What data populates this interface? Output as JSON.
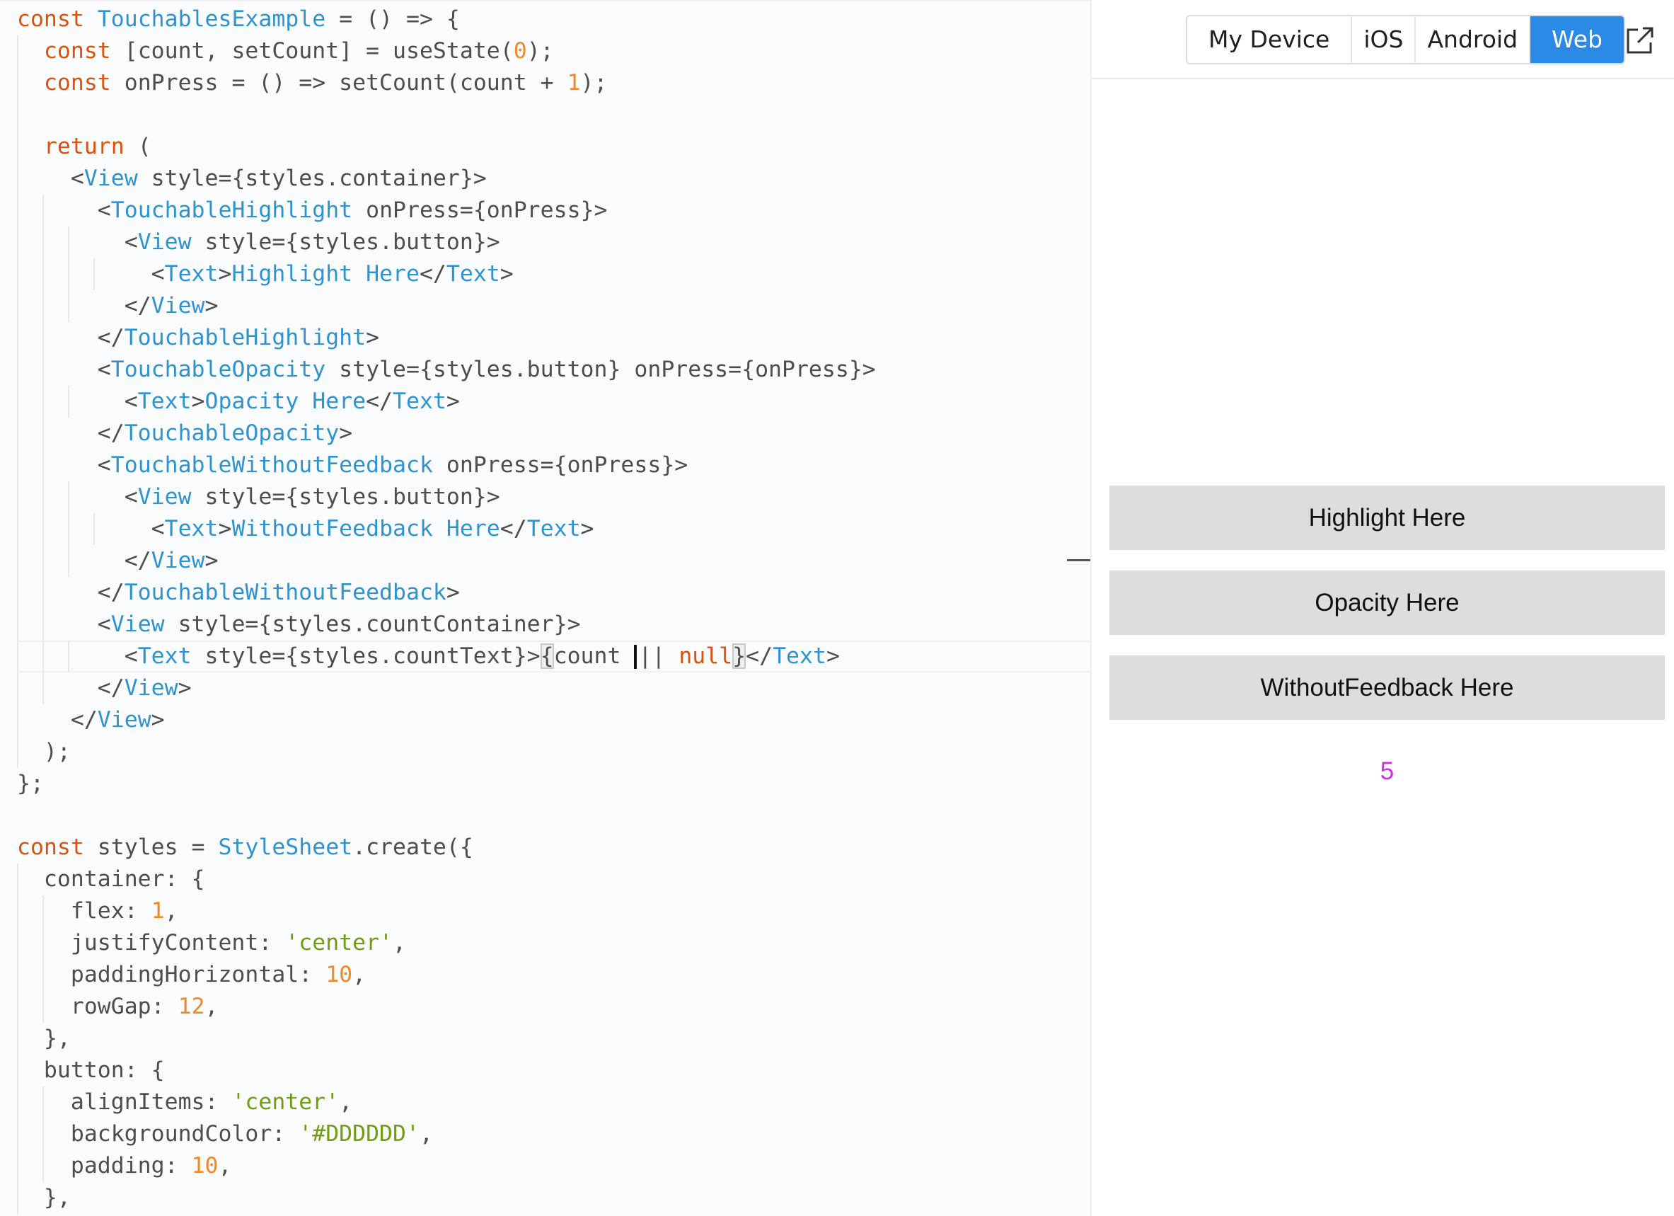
{
  "editor": {
    "lines": [
      [
        [
          "kw",
          "const "
        ],
        [
          "cm",
          "TouchablesExample"
        ],
        [
          "pl",
          " = () => {"
        ]
      ],
      [
        [
          "pl",
          "  "
        ],
        [
          "kw",
          "const "
        ],
        [
          "pl",
          "[count, setCount] = useState("
        ],
        [
          "nu",
          "0"
        ],
        [
          "pl",
          ");"
        ]
      ],
      [
        [
          "pl",
          "  "
        ],
        [
          "kw",
          "const "
        ],
        [
          "pl",
          "onPress = () => setCount(count + "
        ],
        [
          "nu",
          "1"
        ],
        [
          "pl",
          ");"
        ]
      ],
      [],
      [
        [
          "pl",
          "  "
        ],
        [
          "kw",
          "return"
        ],
        [
          "pl",
          " ("
        ]
      ],
      [
        [
          "pl",
          "    <"
        ],
        [
          "cm",
          "View"
        ],
        [
          "pl",
          " style={styles.container}>"
        ]
      ],
      [
        [
          "pl",
          "      <"
        ],
        [
          "cm",
          "TouchableHighlight"
        ],
        [
          "pl",
          " onPress={onPress}>"
        ]
      ],
      [
        [
          "pl",
          "        <"
        ],
        [
          "cm",
          "View"
        ],
        [
          "pl",
          " style={styles.button}>"
        ]
      ],
      [
        [
          "pl",
          "          <"
        ],
        [
          "cm",
          "Text"
        ],
        [
          "pl",
          ">"
        ],
        [
          "cm",
          "Highlight Here"
        ],
        [
          "pl",
          "</"
        ],
        [
          "cm",
          "Text"
        ],
        [
          "pl",
          ">"
        ]
      ],
      [
        [
          "pl",
          "        </"
        ],
        [
          "cm",
          "View"
        ],
        [
          "pl",
          ">"
        ]
      ],
      [
        [
          "pl",
          "      </"
        ],
        [
          "cm",
          "TouchableHighlight"
        ],
        [
          "pl",
          ">"
        ]
      ],
      [
        [
          "pl",
          "      <"
        ],
        [
          "cm",
          "TouchableOpacity"
        ],
        [
          "pl",
          " style={styles.button} onPress={onPress}>"
        ]
      ],
      [
        [
          "pl",
          "        <"
        ],
        [
          "cm",
          "Text"
        ],
        [
          "pl",
          ">"
        ],
        [
          "cm",
          "Opacity Here"
        ],
        [
          "pl",
          "</"
        ],
        [
          "cm",
          "Text"
        ],
        [
          "pl",
          ">"
        ]
      ],
      [
        [
          "pl",
          "      </"
        ],
        [
          "cm",
          "TouchableOpacity"
        ],
        [
          "pl",
          ">"
        ]
      ],
      [
        [
          "pl",
          "      <"
        ],
        [
          "cm",
          "TouchableWithoutFeedback"
        ],
        [
          "pl",
          " onPress={onPress}>"
        ]
      ],
      [
        [
          "pl",
          "        <"
        ],
        [
          "cm",
          "View"
        ],
        [
          "pl",
          " style={styles.button}>"
        ]
      ],
      [
        [
          "pl",
          "          <"
        ],
        [
          "cm",
          "Text"
        ],
        [
          "pl",
          ">"
        ],
        [
          "cm",
          "WithoutFeedback Here"
        ],
        [
          "pl",
          "</"
        ],
        [
          "cm",
          "Text"
        ],
        [
          "pl",
          ">"
        ]
      ],
      [
        [
          "pl",
          "        </"
        ],
        [
          "cm",
          "View"
        ],
        [
          "pl",
          ">"
        ]
      ],
      [
        [
          "pl",
          "      </"
        ],
        [
          "cm",
          "TouchableWithoutFeedback"
        ],
        [
          "pl",
          ">"
        ]
      ],
      [
        [
          "pl",
          "      <"
        ],
        [
          "cm",
          "View"
        ],
        [
          "pl",
          " style={styles.countContainer}>"
        ]
      ],
      [
        [
          "pl",
          "        <"
        ],
        [
          "cm",
          "Text"
        ],
        [
          "pl",
          " style={styles.countText}>"
        ],
        [
          "bm",
          "{"
        ],
        [
          "pl",
          "count "
        ],
        [
          "cursor",
          ""
        ],
        [
          "pl",
          "|| "
        ],
        [
          "kw",
          "null"
        ],
        [
          "bm",
          "}"
        ],
        [
          "pl",
          "</"
        ],
        [
          "cm",
          "Text"
        ],
        [
          "pl",
          ">"
        ]
      ],
      [
        [
          "pl",
          "      </"
        ],
        [
          "cm",
          "View"
        ],
        [
          "pl",
          ">"
        ]
      ],
      [
        [
          "pl",
          "    </"
        ],
        [
          "cm",
          "View"
        ],
        [
          "pl",
          ">"
        ]
      ],
      [
        [
          "pl",
          "  );"
        ]
      ],
      [
        [
          "pl",
          "};"
        ]
      ],
      [],
      [
        [
          "kw",
          "const "
        ],
        [
          "pl",
          "styles = "
        ],
        [
          "cm",
          "StyleSheet"
        ],
        [
          "pl",
          ".create({"
        ]
      ],
      [
        [
          "pl",
          "  container: {"
        ]
      ],
      [
        [
          "pl",
          "    flex: "
        ],
        [
          "nu",
          "1"
        ],
        [
          "pl",
          ","
        ]
      ],
      [
        [
          "pl",
          "    justifyContent: "
        ],
        [
          "st",
          "'center'"
        ],
        [
          "pl",
          ","
        ]
      ],
      [
        [
          "pl",
          "    paddingHorizontal: "
        ],
        [
          "nu",
          "10"
        ],
        [
          "pl",
          ","
        ]
      ],
      [
        [
          "pl",
          "    rowGap: "
        ],
        [
          "nu",
          "12"
        ],
        [
          "pl",
          ","
        ]
      ],
      [
        [
          "pl",
          "  },"
        ]
      ],
      [
        [
          "pl",
          "  button: {"
        ]
      ],
      [
        [
          "pl",
          "    alignItems: "
        ],
        [
          "st",
          "'center'"
        ],
        [
          "pl",
          ","
        ]
      ],
      [
        [
          "pl",
          "    backgroundColor: "
        ],
        [
          "st",
          "'#DDDDDD'"
        ],
        [
          "pl",
          ","
        ]
      ],
      [
        [
          "pl",
          "    padding: "
        ],
        [
          "nu",
          "10"
        ],
        [
          "pl",
          ","
        ]
      ],
      [
        [
          "pl",
          "  },"
        ]
      ]
    ]
  },
  "preview": {
    "platforms": [
      "My Device",
      "iOS",
      "Android",
      "Web"
    ],
    "active_platform": "Web",
    "buttons": {
      "highlight_label": "Highlight Here",
      "opacity_label": "Opacity Here",
      "without_feedback_label": "WithoutFeedback Here"
    },
    "count_value": "5"
  },
  "colors": {
    "accent": "#2b8ae6",
    "button_bg": "#DDDDDD",
    "count_text": "#d52be3"
  },
  "icons": {
    "open_external": "external-link-icon"
  }
}
